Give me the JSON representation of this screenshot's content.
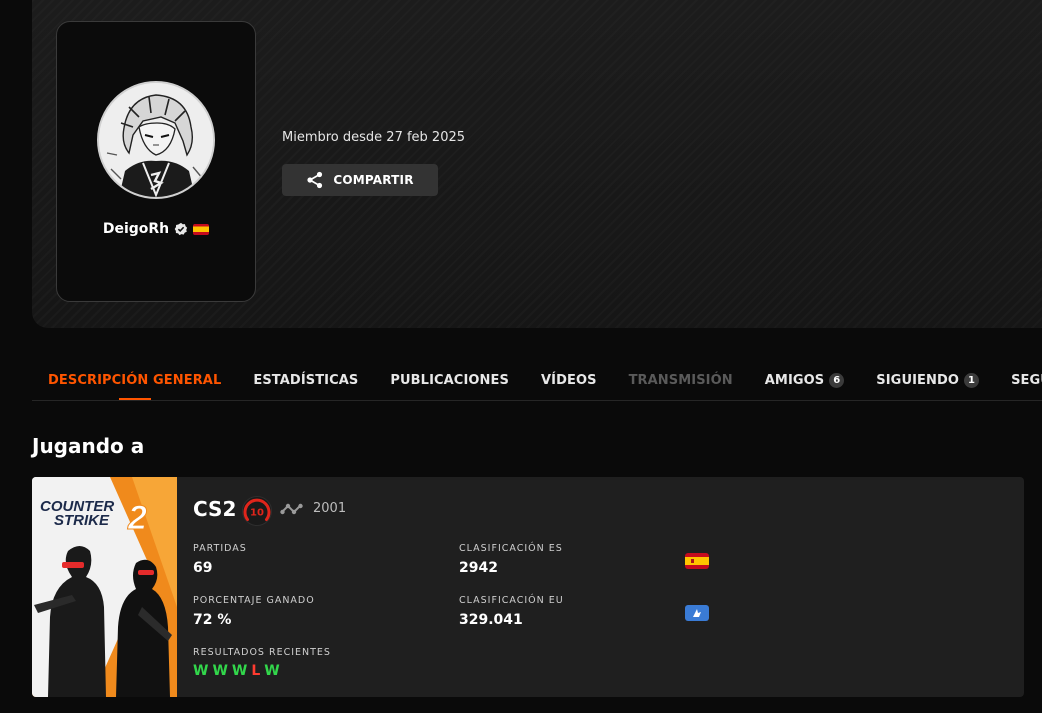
{
  "profile": {
    "username": "DeigoRh",
    "member_since": "Miembro desde 27 feb 2025",
    "share_label": "COMPARTIR",
    "country_flag": "es-flag-icon"
  },
  "tabs": [
    {
      "label": "DESCRIPCIÓN GENERAL",
      "state": "active"
    },
    {
      "label": "ESTADÍSTICAS",
      "state": "normal"
    },
    {
      "label": "PUBLICACIONES",
      "state": "normal"
    },
    {
      "label": "VÍDEOS",
      "state": "normal"
    },
    {
      "label": "TRANSMISIÓN",
      "state": "disabled"
    },
    {
      "label": "AMIGOS",
      "count": "6",
      "state": "normal"
    },
    {
      "label": "SIGUIENDO",
      "count": "1",
      "state": "normal"
    },
    {
      "label": "SEGUIDO",
      "state": "normal"
    }
  ],
  "section": {
    "title": "Jugando a"
  },
  "game": {
    "cover_title_line1": "COUNTER",
    "cover_title_line2": "STRIKE",
    "cover_number": "2",
    "name": "CS2",
    "level": "10",
    "elo": "2001",
    "stats": {
      "matches_label": "PARTIDAS",
      "matches_value": "69",
      "winrate_label": "PORCENTAJE GANADO",
      "winrate_value": "72 %",
      "recent_label": "RESULTADOS RECIENTES",
      "ranking_country_label": "CLASIFICACIÓN ES",
      "ranking_country_value": "2942",
      "ranking_region_label": "CLASIFICACIÓN EU",
      "ranking_region_value": "329.041"
    },
    "recent_results": [
      "W",
      "W",
      "W",
      "L",
      "W"
    ]
  },
  "colors": {
    "accent": "#ff5500",
    "win": "#32d74b",
    "loss": "#ff3b30",
    "level_badge": "#e0251b"
  }
}
